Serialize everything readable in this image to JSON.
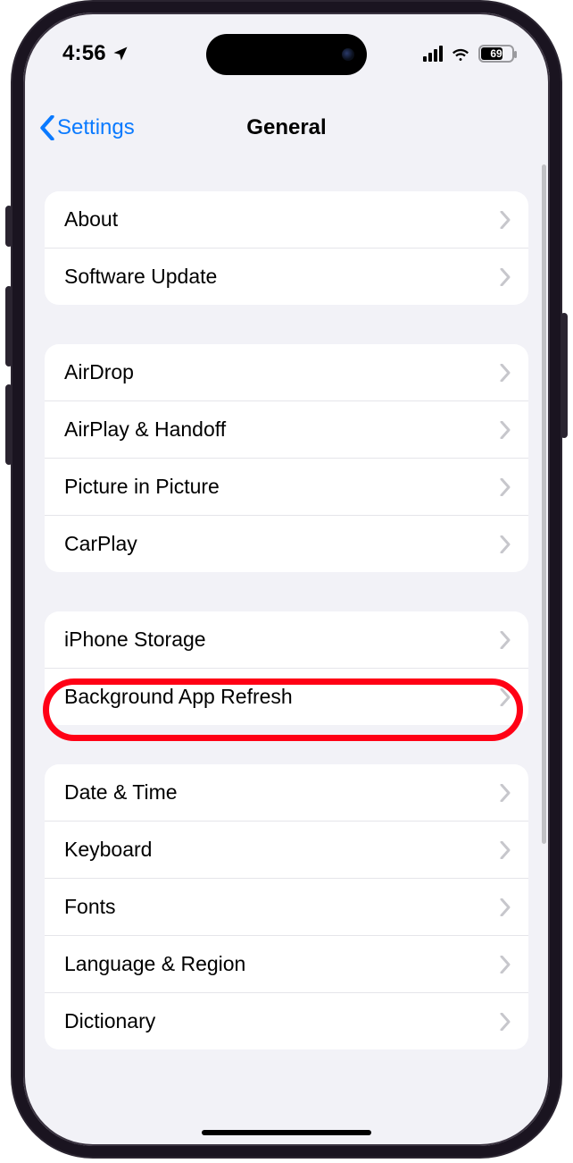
{
  "status": {
    "time": "4:56",
    "battery_pct": "69"
  },
  "nav": {
    "back_label": "Settings",
    "title": "General"
  },
  "groups": [
    {
      "items": [
        {
          "id": "about",
          "label": "About"
        },
        {
          "id": "software-update",
          "label": "Software Update"
        }
      ]
    },
    {
      "items": [
        {
          "id": "airdrop",
          "label": "AirDrop"
        },
        {
          "id": "airplay-handoff",
          "label": "AirPlay & Handoff"
        },
        {
          "id": "pip",
          "label": "Picture in Picture"
        },
        {
          "id": "carplay",
          "label": "CarPlay"
        }
      ]
    },
    {
      "items": [
        {
          "id": "iphone-storage",
          "label": "iPhone Storage",
          "highlighted": true
        },
        {
          "id": "bg-refresh",
          "label": "Background App Refresh"
        }
      ]
    },
    {
      "items": [
        {
          "id": "date-time",
          "label": "Date & Time"
        },
        {
          "id": "keyboard",
          "label": "Keyboard"
        },
        {
          "id": "fonts",
          "label": "Fonts"
        },
        {
          "id": "lang-region",
          "label": "Language & Region"
        },
        {
          "id": "dictionary",
          "label": "Dictionary"
        }
      ]
    }
  ]
}
